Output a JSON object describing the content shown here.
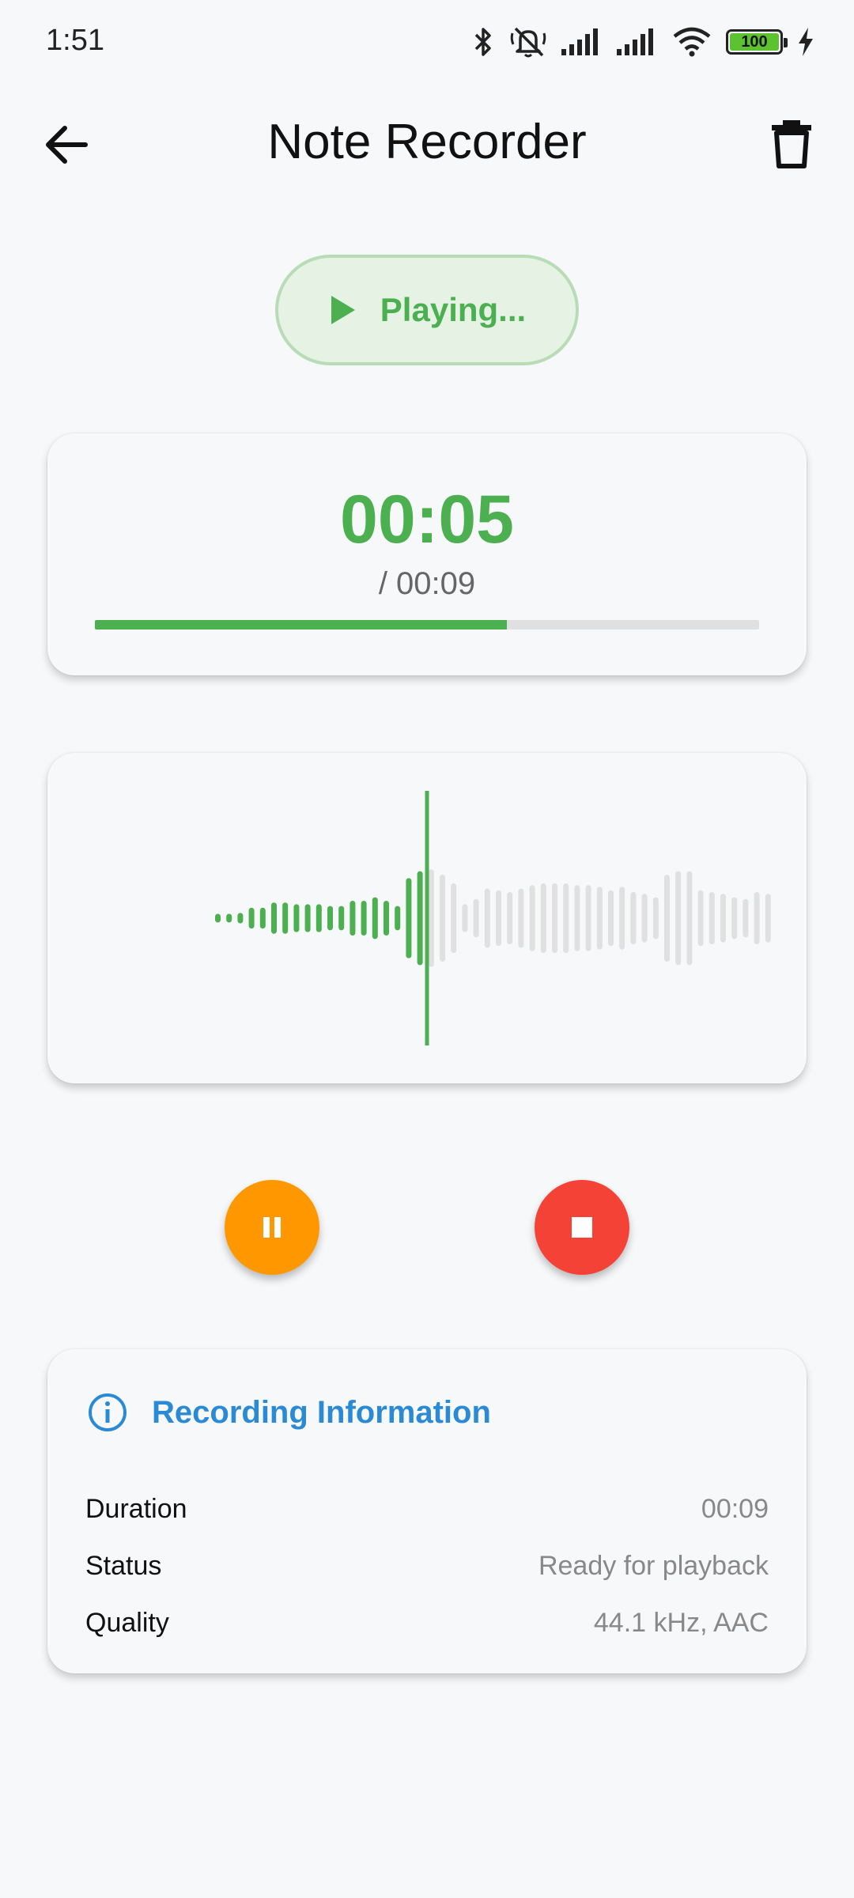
{
  "status_bar": {
    "time": "1:51",
    "battery_level": "100",
    "icons": [
      "bluetooth-icon",
      "muted-bell-icon",
      "signal-icon",
      "signal-icon",
      "wifi-icon",
      "battery-icon",
      "charging-icon"
    ]
  },
  "app_bar": {
    "title": "Note Recorder",
    "back_icon": "arrow-left-icon",
    "delete_icon": "trash-icon"
  },
  "playback_chip": {
    "label": "Playing...",
    "icon": "play-icon"
  },
  "timer": {
    "current": "00:05",
    "total": "/ 00:09",
    "progress": 0.62
  },
  "waveform": {
    "playhead_fraction": 0.5,
    "bars": [
      0.05,
      0.05,
      0.06,
      0.12,
      0.12,
      0.18,
      0.18,
      0.16,
      0.16,
      0.16,
      0.14,
      0.14,
      0.2,
      0.2,
      0.24,
      0.2,
      0.14,
      0.46,
      0.54,
      0.56,
      0.5,
      0.4,
      0.16,
      0.22,
      0.34,
      0.32,
      0.3,
      0.34,
      0.38,
      0.4,
      0.4,
      0.4,
      0.38,
      0.38,
      0.36,
      0.32,
      0.36,
      0.3,
      0.28,
      0.24,
      0.5,
      0.54,
      0.54,
      0.32,
      0.3,
      0.28,
      0.24,
      0.22,
      0.3,
      0.28
    ],
    "played_color": "#4caf50",
    "unplayed_color": "#e0e0e0"
  },
  "controls": {
    "pause_icon": "pause-icon",
    "stop_icon": "stop-icon",
    "pause_color": "#ff9800",
    "stop_color": "#f44336"
  },
  "info": {
    "title": "Recording Information",
    "icon": "info-icon",
    "rows": [
      {
        "key": "Duration",
        "value": "00:09"
      },
      {
        "key": "Status",
        "value": "Ready for playback"
      },
      {
        "key": "Quality",
        "value": "44.1 kHz, AAC"
      }
    ]
  },
  "colors": {
    "accent_green": "#4caf50",
    "info_blue": "#2b8ad6",
    "background": "#f7f8fa"
  }
}
